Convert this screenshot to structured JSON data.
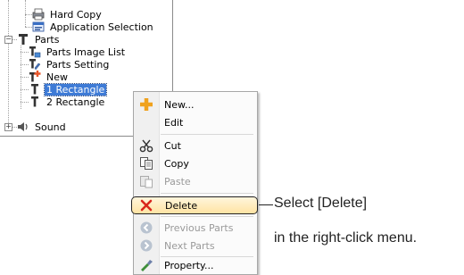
{
  "tree": {
    "items": [
      {
        "label": "Hard Copy",
        "icon": "hard-copy-icon"
      },
      {
        "label": "Application Selection",
        "icon": "application-selection-icon"
      },
      {
        "label": "Parts",
        "icon": "parts-icon"
      },
      {
        "label": "Parts Image List",
        "icon": "parts-image-list-icon"
      },
      {
        "label": "Parts Setting",
        "icon": "parts-setting-icon"
      },
      {
        "label": "New",
        "icon": "new-part-icon"
      },
      {
        "label": "1 Rectangle",
        "icon": "part-icon"
      },
      {
        "label": "2 Rectangle",
        "icon": "part-icon"
      },
      {
        "label": "Sound",
        "icon": "sound-icon"
      }
    ],
    "selected": "1 Rectangle"
  },
  "context_menu": {
    "items": [
      {
        "label": "New...",
        "icon": "new-icon",
        "enabled": true
      },
      {
        "label": "Edit",
        "icon": "",
        "enabled": true
      },
      {
        "label": "Cut",
        "icon": "scissors-icon",
        "enabled": true
      },
      {
        "label": "Copy",
        "icon": "copy-icon",
        "enabled": true
      },
      {
        "label": "Paste",
        "icon": "paste-icon",
        "enabled": false
      },
      {
        "label": "Delete",
        "icon": "delete-x-icon",
        "enabled": true,
        "highlighted": true
      },
      {
        "label": "Previous Parts",
        "icon": "arrow-left-circle-icon",
        "enabled": false
      },
      {
        "label": "Next Parts",
        "icon": "arrow-right-circle-icon",
        "enabled": false
      },
      {
        "label": "Property...",
        "icon": "property-icon",
        "enabled": true
      }
    ]
  },
  "callout": {
    "line1": "Select [Delete]",
    "line2": "in the right-click menu."
  },
  "colors": {
    "selection": "#3e7bd6",
    "highlight_top": "#fff6dc",
    "highlight_bottom": "#ffe3a3",
    "delete_red": "#d9261c",
    "disabled_text": "#9a9a9a"
  }
}
